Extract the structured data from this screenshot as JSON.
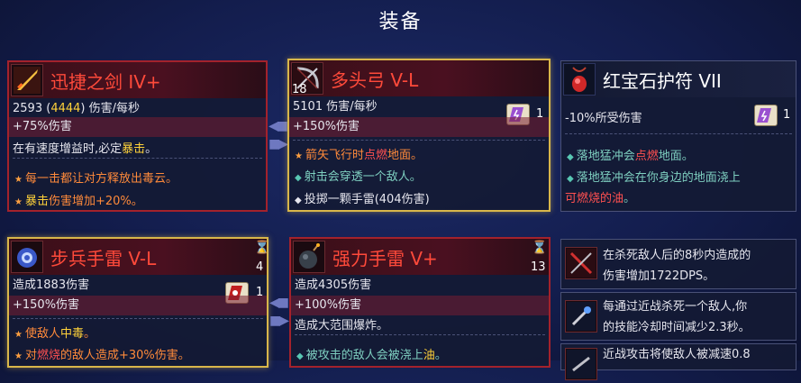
{
  "title": "装备",
  "colors": {
    "rare": "#ff4a3a",
    "highlight": "#ffd23a",
    "border_red": "#a3222c",
    "border_gold": "#d8b64a"
  },
  "cards": {
    "sword": {
      "icon": "sword-icon",
      "name": "迅捷之剑 IV+",
      "dps_base": "2593",
      "dps_boost": "4444",
      "dps_suffix": "伤害/每秒",
      "bonus": "+75%伤害",
      "cond_prefix": "在有速度增益时,必定",
      "cond_hl": "暴击",
      "cond_end": "。",
      "eff1": "每一击都让对方释放出毒云。",
      "eff2_hl": "暴击",
      "eff2": "伤害增加+20%。"
    },
    "bow": {
      "icon": "bow-icon",
      "level": "18",
      "name": "多头弓 V-L",
      "dps": "5101 伤害/每秒",
      "bonus": "+150%伤害",
      "tag_count": "1",
      "eff1_a": "箭矢飞行时",
      "eff1_hl": "点燃",
      "eff1_b": "地面。",
      "eff2": "射击会穿透一个敌人。",
      "eff3": "投掷一颗手雷(404伤害)"
    },
    "amulet": {
      "icon": "amulet-icon",
      "name": "红宝石护符 VII",
      "stat": "-10%所受伤害",
      "tag_count": "1",
      "eff1_a": "落地猛冲会",
      "eff1_hl": "点燃",
      "eff1_b": "地面。",
      "eff2": "落地猛冲会在你身边的地面浇上",
      "eff2_red": "可燃烧的油",
      "eff2_end": "。"
    },
    "grenade": {
      "icon": "grenade-icon",
      "name": "步兵手雷 V-L",
      "charges": "4",
      "dmg": "造成1883伤害",
      "bonus": "+150%伤害",
      "tag_count": "1",
      "eff1_a": "使敌人",
      "eff1_hl": "中毒",
      "eff1_b": "。",
      "eff2_a": "对",
      "eff2_hl": "燃烧",
      "eff2_b": "的敌人造成+30%伤害。"
    },
    "power_grenade": {
      "icon": "bomb-icon",
      "name": "强力手雷 V+",
      "charges": "13",
      "dmg": "造成4305伤害",
      "bonus": "+100%伤害",
      "eff1": "造成大范围爆炸。",
      "eff2_a": "被攻击的敌人会被浇上",
      "eff2_red": "油",
      "eff2_b": "。"
    },
    "perks": [
      {
        "icon": "crossed-blade-icon",
        "line1": "在杀死敌人后的8秒内造成的",
        "line2": "伤害增加1722DPS。"
      },
      {
        "icon": "cooldown-icon",
        "line1": "每通过近战杀死一个敌人,你",
        "line2": "的技能冷却时间减少2.3秒。"
      },
      {
        "icon": "slow-icon",
        "line1": "近战攻击将使敌人被减速0.8"
      }
    ]
  }
}
